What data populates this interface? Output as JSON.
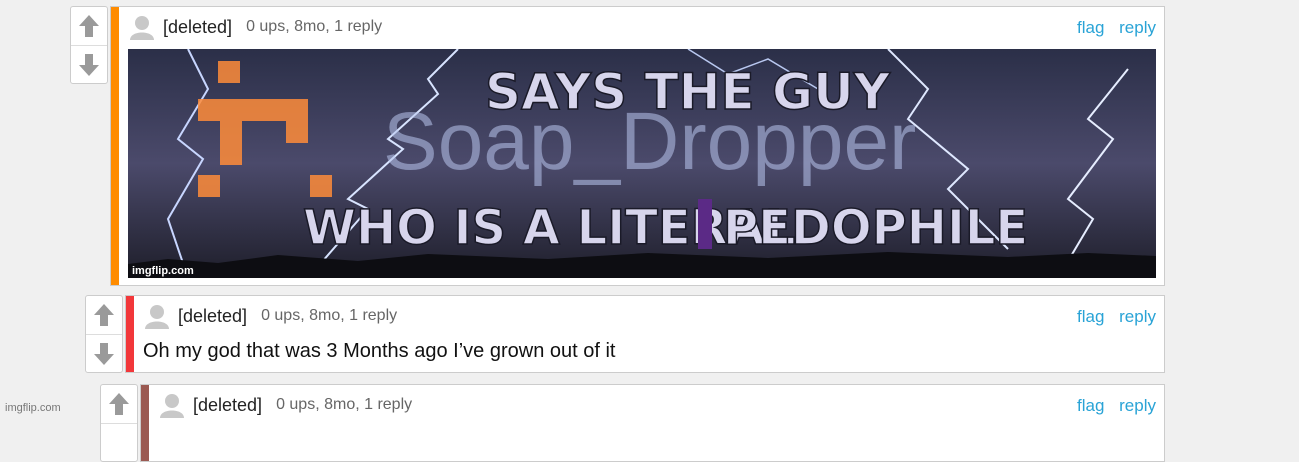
{
  "comments": [
    {
      "user": "[deleted]",
      "meta": "0 ups, 8mo, 1 reply",
      "flag": "flag",
      "reply": "reply",
      "bar_color": "#ff8c00",
      "image": {
        "line1": "SAYS THE GUY",
        "watermark_name": "Soap_Dropper",
        "line2": "WHO IS A LITERAL",
        "line2_end": "PEDOPHILE",
        "credit": "imgflip.com"
      }
    },
    {
      "user": "[deleted]",
      "meta": "0 ups, 8mo, 1 reply",
      "flag": "flag",
      "reply": "reply",
      "bar_color": "#f2373a",
      "text": "Oh my god that was 3 Months ago I’ve grown out of it"
    },
    {
      "user": "[deleted]",
      "meta": "0 ups, 8mo, 1 reply",
      "flag": "flag",
      "reply": "reply",
      "bar_color": "#9b5a52"
    }
  ],
  "footer": {
    "site": "imgflip.com"
  }
}
